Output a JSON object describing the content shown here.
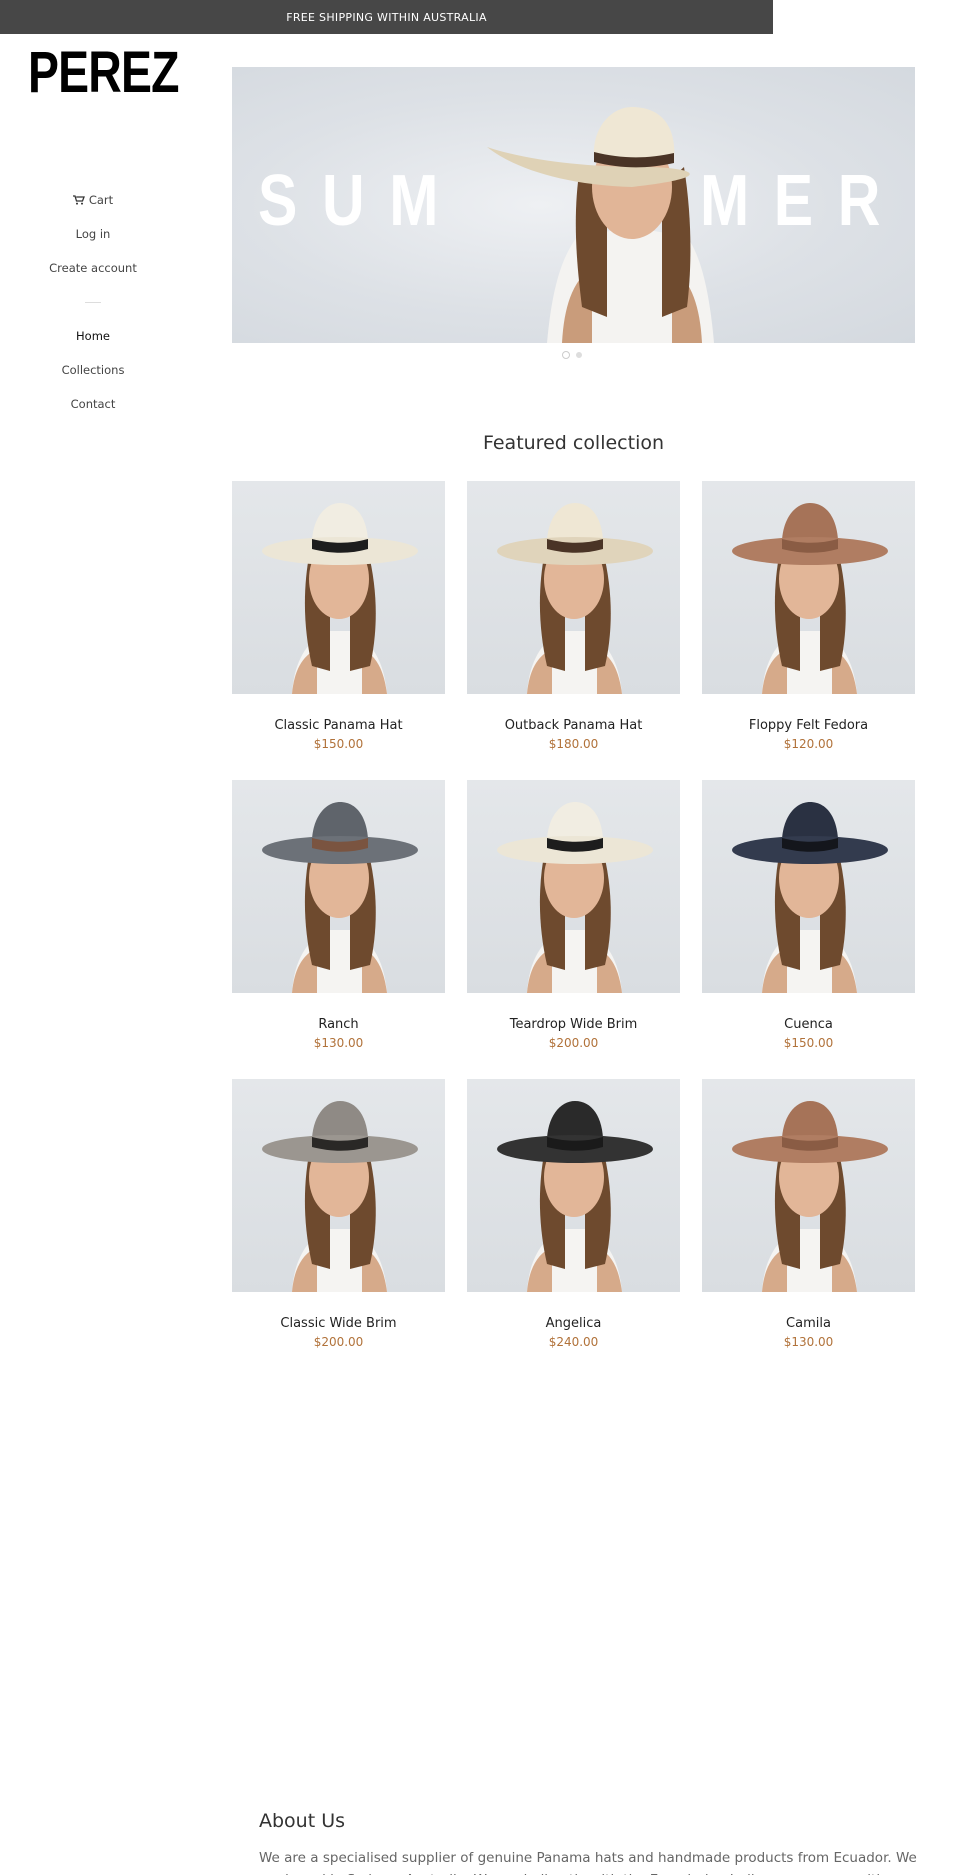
{
  "announcement": "FREE SHIPPING WITHIN AUSTRALIA",
  "logo": "PEREZ",
  "sidebar": {
    "cart": "Cart",
    "login": "Log in",
    "create_account": "Create account",
    "nav": [
      "Home",
      "Collections",
      "Contact"
    ]
  },
  "hero": {
    "left_text": "SUM",
    "right_text": "MER"
  },
  "featured_title": "Featured collection",
  "products": [
    {
      "name": "Classic Panama Hat",
      "price": "$150.00",
      "hat": "panama-cream-black-band"
    },
    {
      "name": "Outback Panama Hat",
      "price": "$180.00",
      "hat": "panama-beige-brown-band"
    },
    {
      "name": "Floppy Felt Fedora",
      "price": "$120.00",
      "hat": "felt-tan"
    },
    {
      "name": "Ranch",
      "price": "$130.00",
      "hat": "wide-grey"
    },
    {
      "name": "Teardrop Wide Brim",
      "price": "$200.00",
      "hat": "panama-cream-black-band"
    },
    {
      "name": "Cuenca",
      "price": "$150.00",
      "hat": "navy-fedora"
    },
    {
      "name": "Classic Wide Brim",
      "price": "$200.00",
      "hat": "grey-wide"
    },
    {
      "name": "Angelica",
      "price": "$240.00",
      "hat": "black-lace"
    },
    {
      "name": "Camila",
      "price": "$130.00",
      "hat": "felt-tan"
    }
  ],
  "about": {
    "title": "About Us",
    "text": "We are a specialised supplier of genuine Panama hats and handmade products from Ecuador. We are based in Sydney, Australia. We work directly with the Ecuadorian Indigenous communities and artisans"
  },
  "colors": {
    "price": "#b1723a",
    "announcement_bg": "#474747"
  }
}
